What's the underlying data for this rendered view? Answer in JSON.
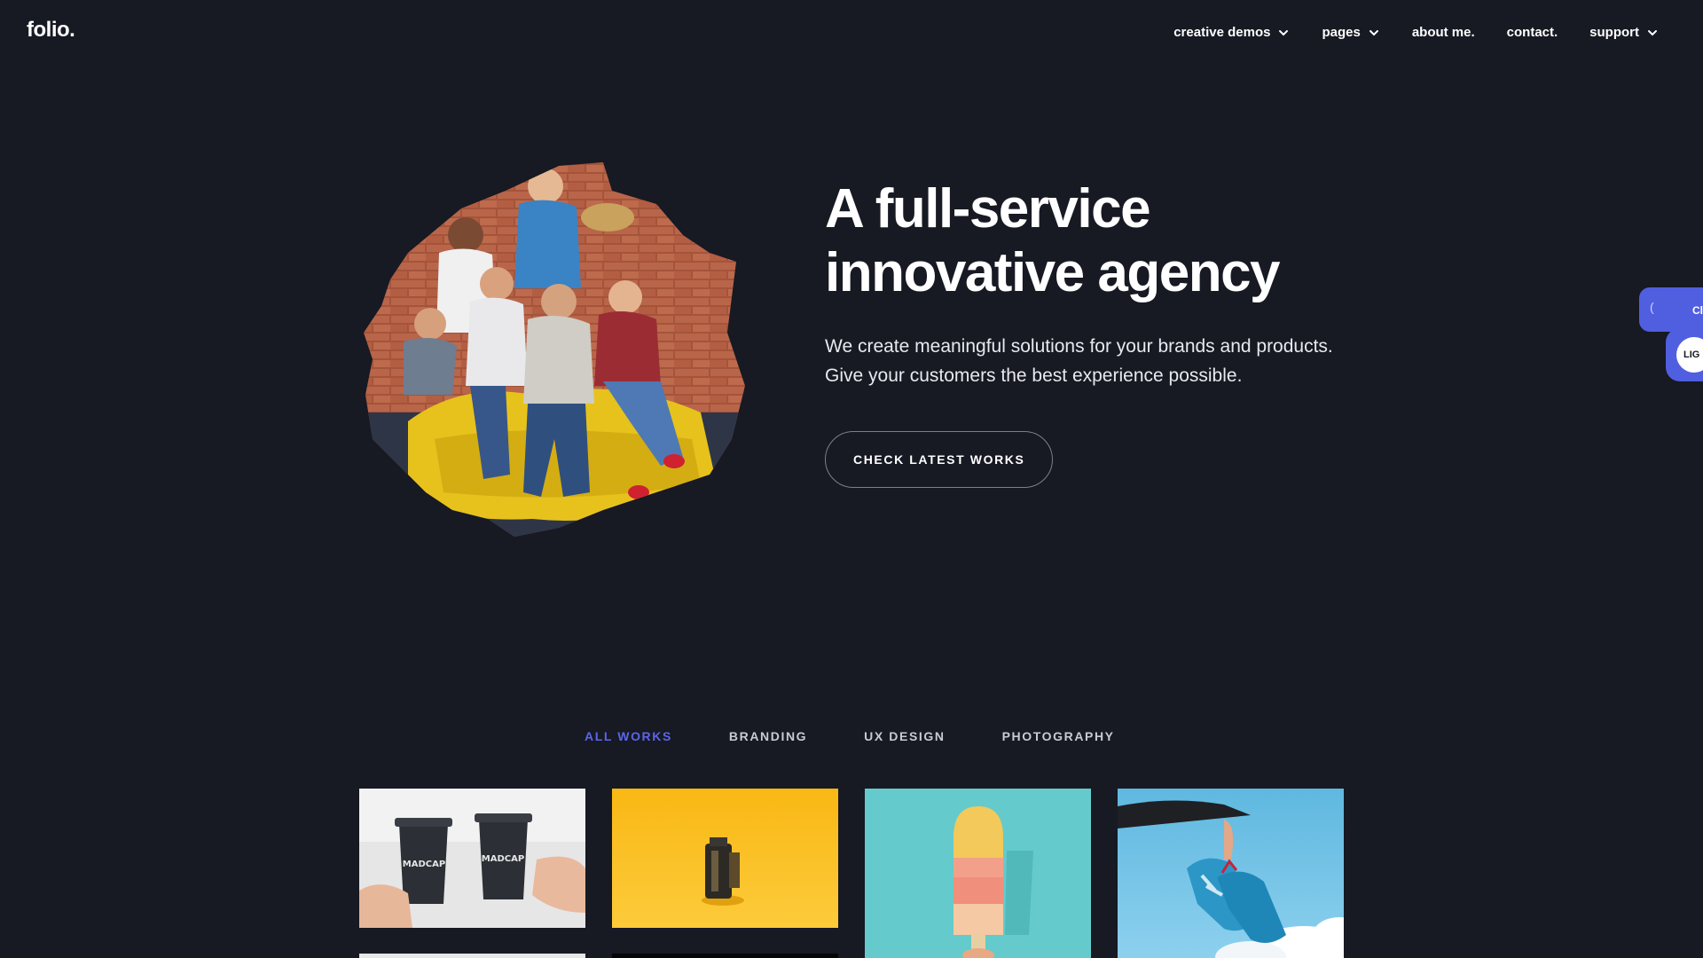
{
  "header": {
    "logo": "folio.",
    "nav": [
      {
        "label": "creative demos",
        "has_dropdown": true
      },
      {
        "label": "pages",
        "has_dropdown": true
      },
      {
        "label": "about me.",
        "has_dropdown": false
      },
      {
        "label": "contact.",
        "has_dropdown": false
      },
      {
        "label": "support",
        "has_dropdown": true
      }
    ]
  },
  "hero": {
    "title_line1": "A full-service",
    "title_line2": "innovative agency",
    "subtitle_line1": "We create meaningful solutions for your brands and products.",
    "subtitle_line2": "Give your customers the best experience possible.",
    "button": "CHECK LATEST WORKS",
    "image_icon": "team-photo-brush-mask"
  },
  "side_widget": {
    "tab_glyph": "(",
    "tab_label": "Cl",
    "pill_label": "LIG"
  },
  "portfolio": {
    "filters": [
      {
        "label": "ALL WORKS",
        "active": true
      },
      {
        "label": "BRANDING",
        "active": false
      },
      {
        "label": "UX DESIGN",
        "active": false
      },
      {
        "label": "PHOTOGRAPHY",
        "active": false
      }
    ],
    "thumbnails": [
      {
        "name": "coffee-cups-image",
        "cup_text": "MADCAP"
      },
      {
        "name": "film-roll-image"
      },
      {
        "name": "popsicle-image"
      },
      {
        "name": "sneakers-image"
      }
    ]
  },
  "colors": {
    "background": "#171923",
    "accent": "#5a66e8",
    "text": "#ffffff"
  }
}
